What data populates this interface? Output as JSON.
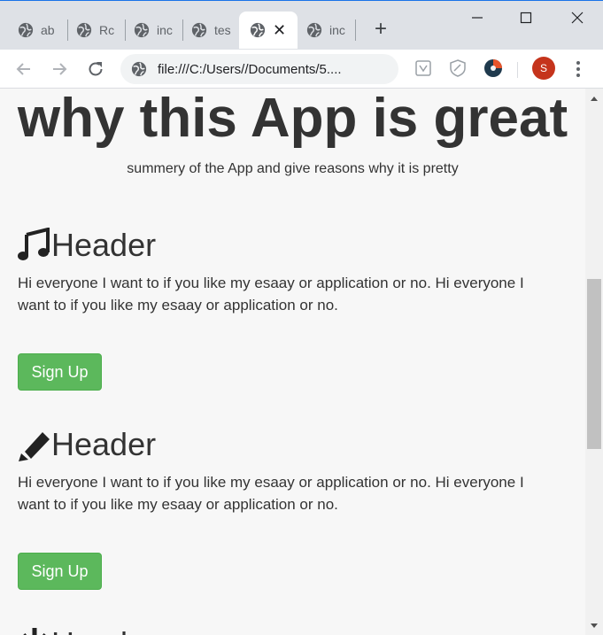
{
  "browser": {
    "tabs": [
      {
        "title": "ab"
      },
      {
        "title": "Rc"
      },
      {
        "title": "inc"
      },
      {
        "title": "tes"
      },
      {
        "title": "",
        "active": true
      },
      {
        "title": "inc"
      }
    ],
    "new_tab_label": "+",
    "close_tab_glyph": "✕",
    "url": "file:///C:/Users//Documents/5....",
    "profile_initial": "S",
    "profile_color": "#c5341c"
  },
  "page": {
    "title": "why this App is great",
    "subtitle": "summery of the App and give reasons why it is pretty",
    "features": [
      {
        "icon": "music-note-icon",
        "title": "Header",
        "text": "Hi everyone I want to if you like my esaay or application or no. Hi everyone I want to if you like my esaay or application or no.",
        "button": "Sign Up"
      },
      {
        "icon": "pencil-icon",
        "title": "Header",
        "text": "Hi everyone I want to if you like my esaay or application or no. Hi everyone I want to if you like my esaay or application or no.",
        "button": "Sign Up"
      },
      {
        "icon": "power-icon",
        "title": "Header"
      }
    ],
    "button_color": "#5cb85c"
  }
}
